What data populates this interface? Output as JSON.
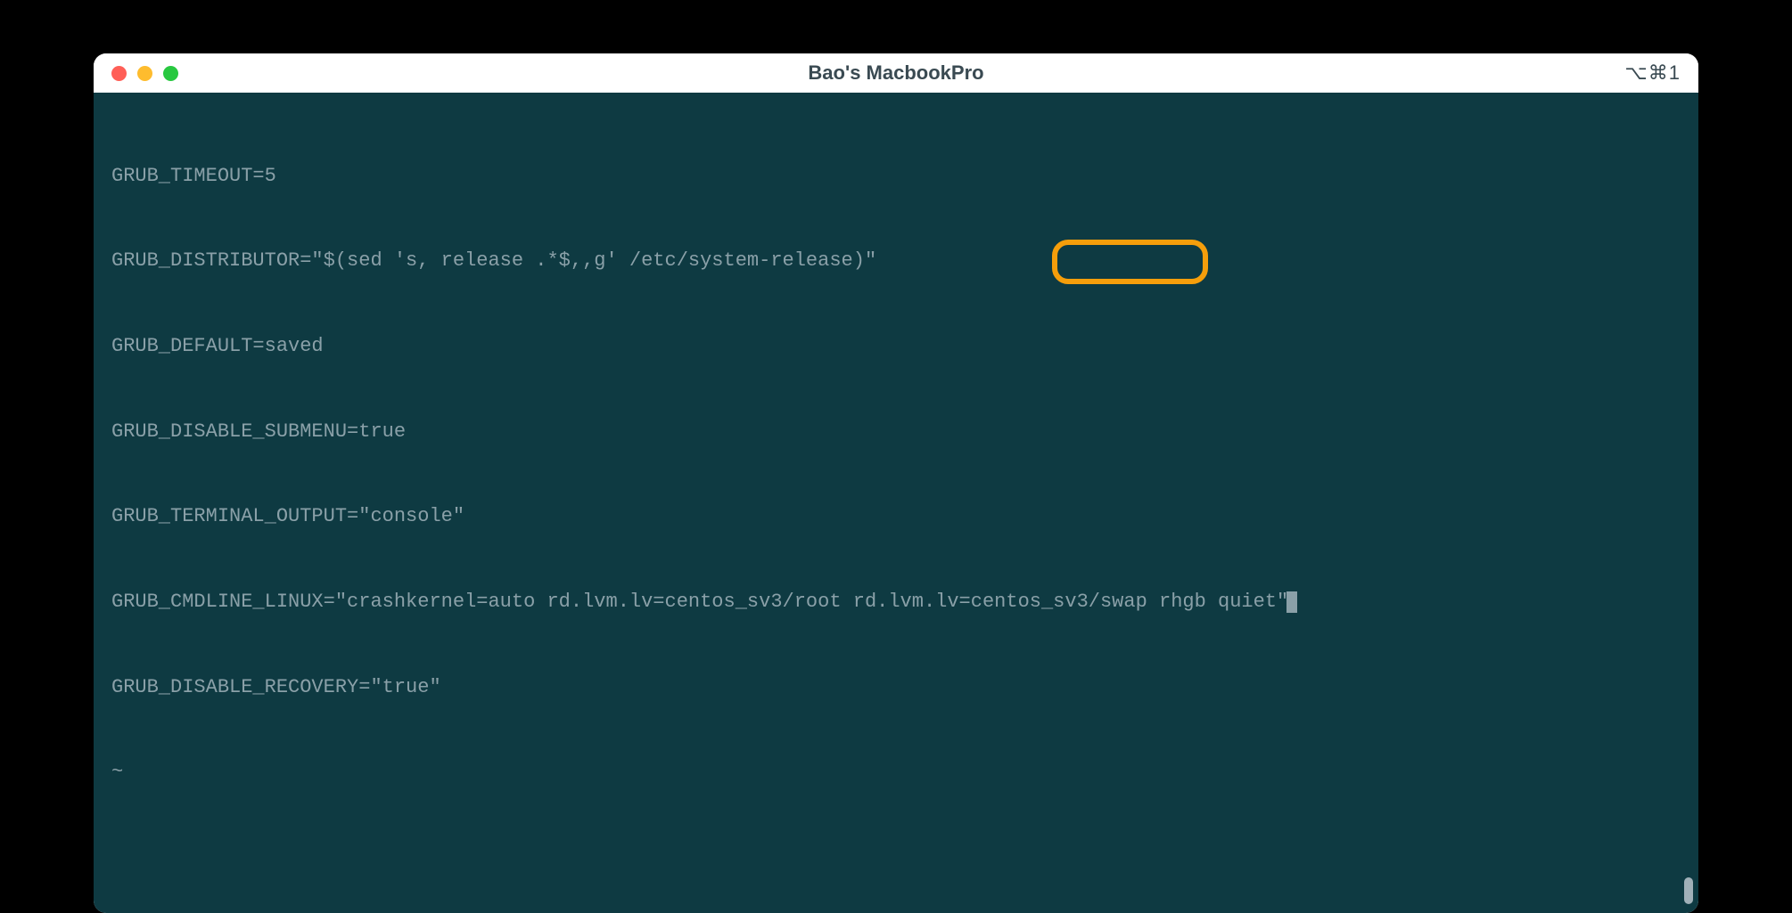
{
  "window": {
    "title": "Bao's MacbookPro",
    "shortcut": "⌥⌘1"
  },
  "terminal": {
    "lines": [
      "GRUB_TIMEOUT=5",
      "GRUB_DISTRIBUTOR=\"$(sed 's, release .*$,,g' /etc/system-release)\"",
      "GRUB_DEFAULT=saved",
      "GRUB_DISABLE_SUBMENU=true",
      "GRUB_TERMINAL_OUTPUT=\"console\"",
      "GRUB_CMDLINE_LINUX=\"crashkernel=auto rd.lvm.lv=centos_sv3/root rd.lvm.lv=centos_sv3/swap rhgb quiet\"",
      "GRUB_DISABLE_RECOVERY=\"true\"",
      "~"
    ],
    "highlighted_text": "rhgb quiet"
  }
}
